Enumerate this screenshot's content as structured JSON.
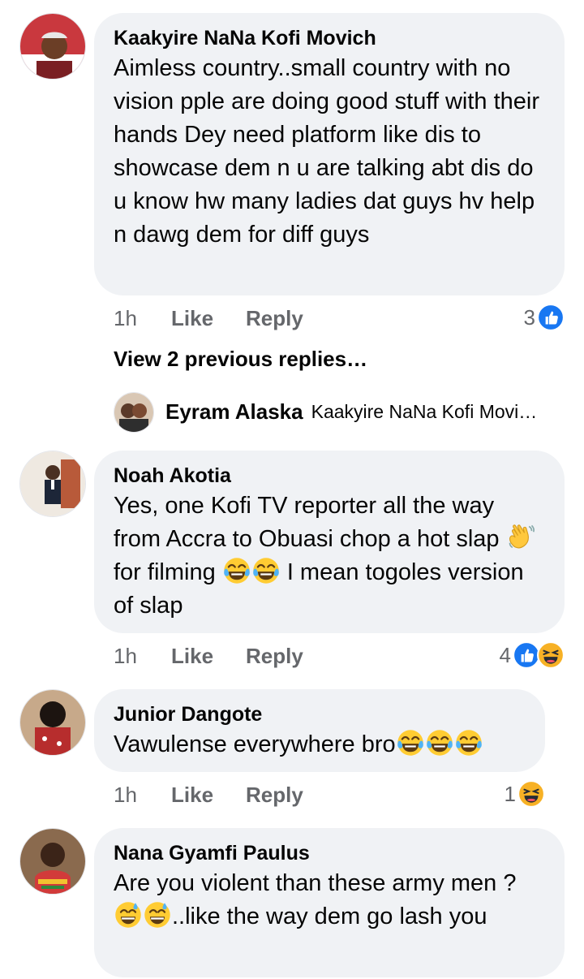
{
  "comments": [
    {
      "author": "Kaakyire NaNa Kofi Movich",
      "text": "Aimless country..small country with no vision pple are doing good stuff with their hands Dey need platform like dis to showcase dem n u are talking abt dis do u know hw many ladies dat guys hv help n dawg dem for diff guys",
      "time": "1h",
      "like": "Like",
      "reply": "Reply",
      "reaction_count": "3",
      "reactions": [
        "like-icon"
      ]
    },
    {
      "author": "Noah Akotia",
      "text_parts": [
        "Yes, one Kofi TV reporter all the way from Accra to Obuasi chop a hot slap ",
        " for filming ",
        " I mean togoles version of slap"
      ],
      "emojis": [
        "waving-hand-emoji",
        "tears-of-joy-emoji",
        "tears-of-joy-emoji"
      ],
      "time": "1h",
      "like": "Like",
      "reply": "Reply",
      "reaction_count": "4",
      "reactions": [
        "like-icon",
        "haha-icon"
      ]
    },
    {
      "author": "Junior Dangote",
      "text": "Vawulense everywhere bro",
      "emojis": [
        "tears-of-joy-emoji",
        "tears-of-joy-emoji",
        "tears-of-joy-emoji"
      ],
      "time": "1h",
      "like": "Like",
      "reply": "Reply",
      "reaction_count": "1",
      "reactions": [
        "haha-icon"
      ]
    },
    {
      "author": "Nana Gyamfi Paulus",
      "text_parts": [
        "Are you violent than these army men ?",
        "..like the way dem go lash you"
      ],
      "emojis": [
        "grinning-sweat-emoji",
        "grinning-sweat-emoji"
      ]
    }
  ],
  "view_previous": "View 2 previous replies…",
  "latest_reply": {
    "author": "Eyram Alaska",
    "text": "Kaakyire NaNa Kofi Movi…"
  },
  "colors": {
    "bubble": "#f0f2f5",
    "meta_text": "#65676b",
    "like_blue": "#1877f2",
    "haha_yellow": "#f7b125"
  }
}
